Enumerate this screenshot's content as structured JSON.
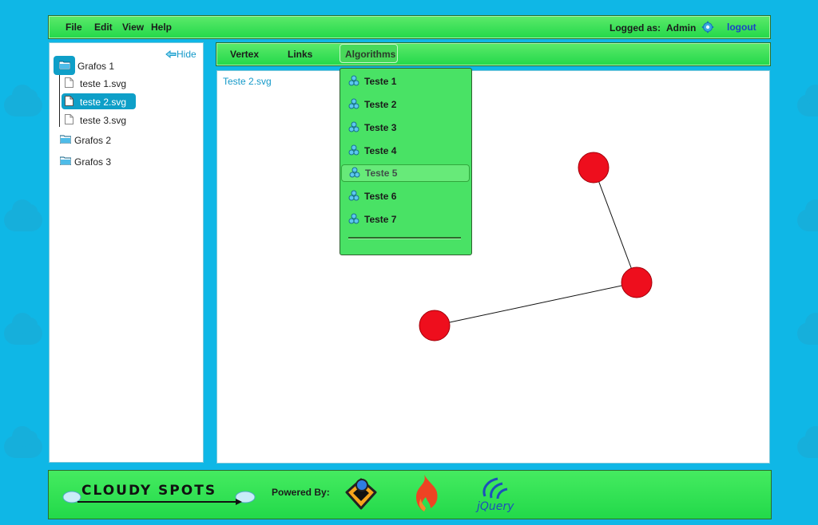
{
  "menubar": {
    "file": "File",
    "edit": "Edit",
    "view": "View",
    "help": "Help",
    "logged_as": "Logged as:",
    "user": "Admin",
    "logout": "logout"
  },
  "sidebar": {
    "hide": "Hide",
    "folders": [
      {
        "label": "Grafos 1",
        "files": [
          "teste 1.svg",
          "teste 2.svg",
          "teste 3.svg"
        ]
      },
      {
        "label": "Grafos 2"
      },
      {
        "label": "Grafos 3"
      }
    ]
  },
  "tabs": {
    "vertex": "Vertex",
    "links": "Links",
    "algorithms": "Algorithms"
  },
  "algorithms_menu": {
    "items": [
      "Teste 1",
      "Teste 2",
      "Teste 3",
      "Teste 4",
      "Teste 5",
      "Teste 6",
      "Teste 7"
    ],
    "hovered_index": 4
  },
  "canvas": {
    "title": "Teste 2.svg"
  },
  "footer": {
    "brand": "CLOUDY SPOTS",
    "powered_by": "Powered By:",
    "jquery": "jQuery"
  },
  "colors": {
    "background": "#0fb7e6",
    "panel_green": "#2edc50",
    "vertex_red": "#ee0e1d",
    "link_blue": "#1499c9"
  }
}
